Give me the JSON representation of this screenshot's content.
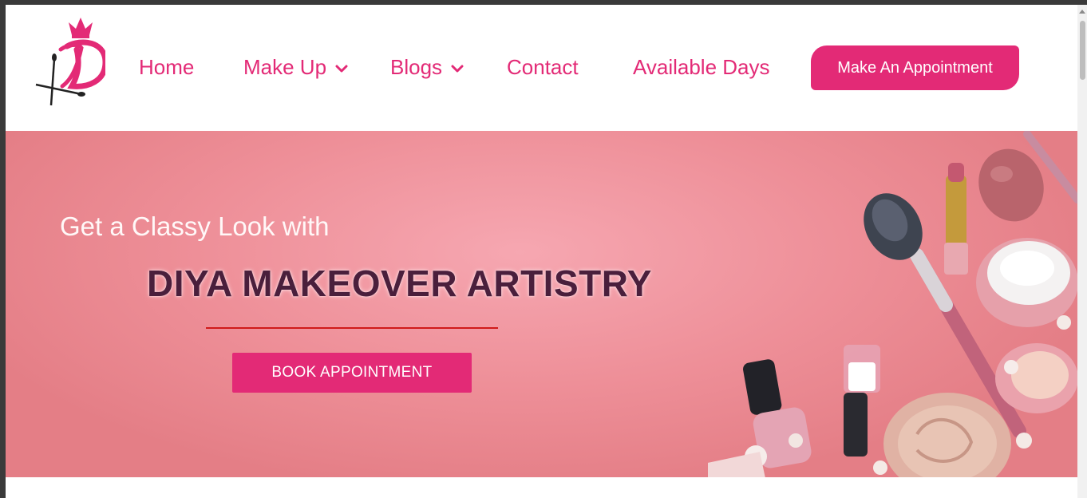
{
  "nav": {
    "home": "Home",
    "makeup": "Make Up",
    "blogs": "Blogs",
    "contact": "Contact",
    "available_days": "Available Days",
    "cta": "Make An Appointment"
  },
  "hero": {
    "subtitle": "Get a Classy Look with",
    "title": "DIYA MAKEOVER ARTISTRY",
    "button": "BOOK APPOINTMENT"
  },
  "colors": {
    "brand_pink": "#e32a76",
    "title_plum": "#4a1f3c",
    "hero_bg": "#ee8f98",
    "rule_red": "#d01a1a"
  },
  "icons": {
    "logo": "crowned-letter-d-with-brushes-logo",
    "dropdown": "chevron-down-icon"
  }
}
